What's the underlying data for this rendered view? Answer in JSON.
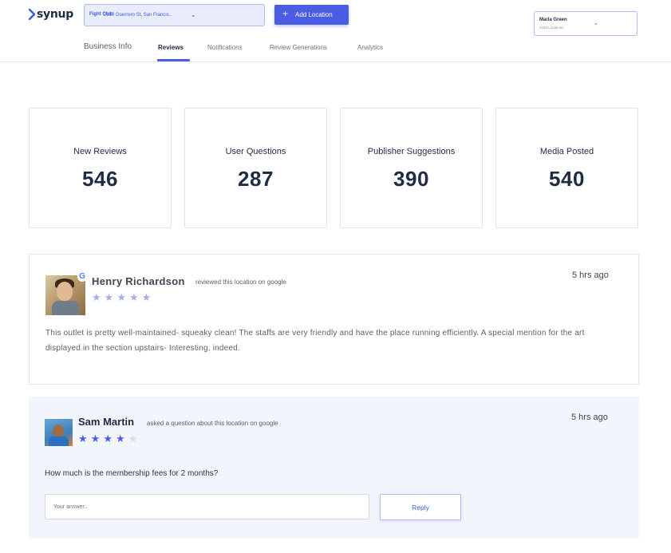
{
  "header": {
    "logo_text": "synup",
    "location_select": {
      "name": "Fight Club",
      "address": "2210 Guerrero St, San Francis..",
      "chevron_icon": "chevron-down-icon"
    },
    "add_location_label": "Add Location",
    "user": {
      "name": "Marla Green",
      "subtitle": "1420 Locations"
    }
  },
  "tabs": [
    {
      "label": "Business Info",
      "active": false
    },
    {
      "label": "Reviews",
      "active": true
    },
    {
      "label": "Notifications",
      "active": false
    },
    {
      "label": "Review Generations",
      "active": false
    },
    {
      "label": "Analytics",
      "active": false
    }
  ],
  "stats": [
    {
      "title": "New Reviews",
      "value": "546"
    },
    {
      "title": "User Questions",
      "value": "287"
    },
    {
      "title": "Publisher Suggestions",
      "value": "390"
    },
    {
      "title": "Media Posted",
      "value": "540"
    }
  ],
  "reviews": [
    {
      "name": "Henry Richardson",
      "action": "reviewed this location on google",
      "time": "5 hrs ago",
      "rating": 5,
      "text": "This outlet is pretty well-maintained- squeaky clean! The staffs are very friendly and have the place running efficiently. A special mention for the art displayed in the section upstairs- Interesting, indeed."
    },
    {
      "name": "Sam Martin",
      "action": "asked a question about this location on google",
      "time": "5 hrs ago",
      "rating": 4,
      "question": "How much is the membership fees for 2 months?",
      "answer_placeholder": "Your answer..",
      "reply_label": "Reply"
    }
  ],
  "colors": {
    "accent": "#4a5de3",
    "star_filled_light": "#a3aef0",
    "star_filled": "#4a5de3",
    "star_empty": "#d6dcf8"
  }
}
